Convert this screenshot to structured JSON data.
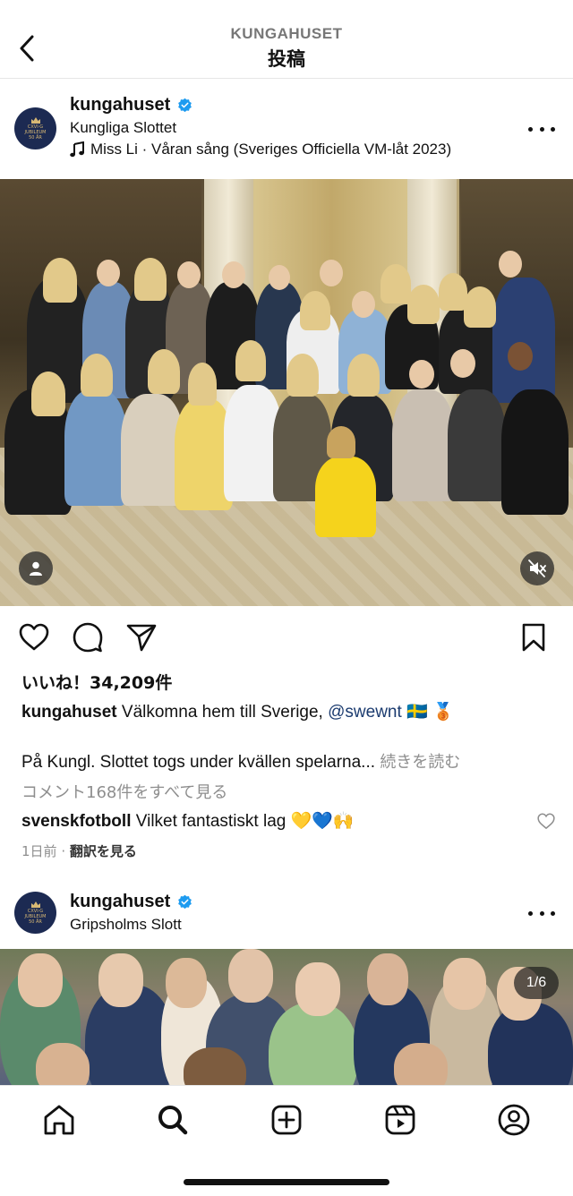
{
  "header": {
    "account_label": "KUNGAHUSET",
    "title": "投稿"
  },
  "post1": {
    "username": "kungahuset",
    "location": "Kungliga Slottet",
    "music": "Miss Li · Våran sång (Sveriges Officiella VM-låt 2023)",
    "avatar_text": [
      "CXVI·G",
      "JUBILEUM",
      "50 ÅR"
    ],
    "likes": "いいね！34,209件",
    "caption_user": "kungahuset",
    "caption_text": "Välkomna hem till Sverige,",
    "caption_mention": "@swewnt",
    "caption_emoji": "🇸🇪 🥉",
    "caption_line2": "På Kungl. Slottet togs under kvällen spelarna...",
    "caption_more": "続きを読む",
    "comments_link": "コメント168件をすべて見る",
    "comment_user": "svenskfotboll",
    "comment_text": "Vilket fantastiskt lag 💛💙🙌",
    "time": "1日前",
    "separator": "·",
    "translate": "翻訳を見る"
  },
  "post2": {
    "username": "kungahuset",
    "location": "Gripsholms Slott",
    "counter": "1/6"
  },
  "icons": {
    "back": "chevron-left-icon",
    "verified": "verified-badge-icon",
    "music": "music-note-icon",
    "more": "more-dots-icon",
    "like": "heart-icon",
    "comment": "comment-icon",
    "share": "send-icon",
    "save": "bookmark-icon",
    "tagged": "person-tag-icon",
    "mute": "speaker-muted-icon"
  },
  "nav": [
    "home",
    "search",
    "create",
    "reels",
    "profile"
  ],
  "colors": {
    "verified": "#1d9bf0",
    "mention": "#1b3b6f",
    "muted_text": "#8e8e8e",
    "avatar_bg": "#1c2a52"
  }
}
